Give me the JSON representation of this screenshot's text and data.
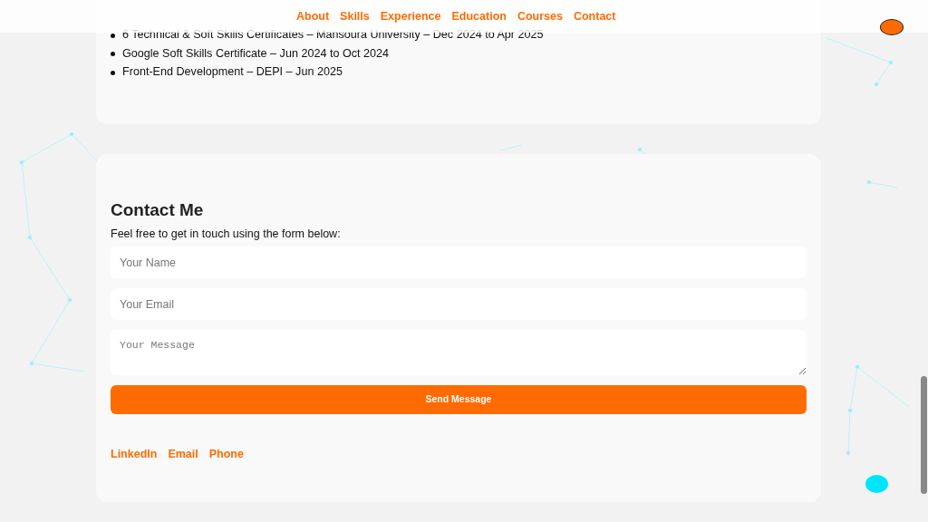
{
  "nav": {
    "links": [
      "About",
      "Skills",
      "Experience",
      "Education",
      "Courses",
      "Contact"
    ]
  },
  "certificates": [
    "6 Technical & Soft Skills Certificates – Mansoura University – Dec 2024 to Apr 2025",
    "Google Soft Skills Certificate – Jun 2024 to Oct 2024",
    "Front-End Development – DEPI – Jun 2025"
  ],
  "contact": {
    "title": "Contact Me",
    "intro": "Feel free to get in touch using the form below:",
    "fields": [
      {
        "kind": "input",
        "placeholder": "Your Name"
      },
      {
        "kind": "input",
        "placeholder": "Your Email"
      },
      {
        "kind": "textarea",
        "placeholder": "Your Message"
      }
    ],
    "button": "Send Message",
    "links": [
      "LinkedIn",
      "Email",
      "Phone"
    ]
  }
}
